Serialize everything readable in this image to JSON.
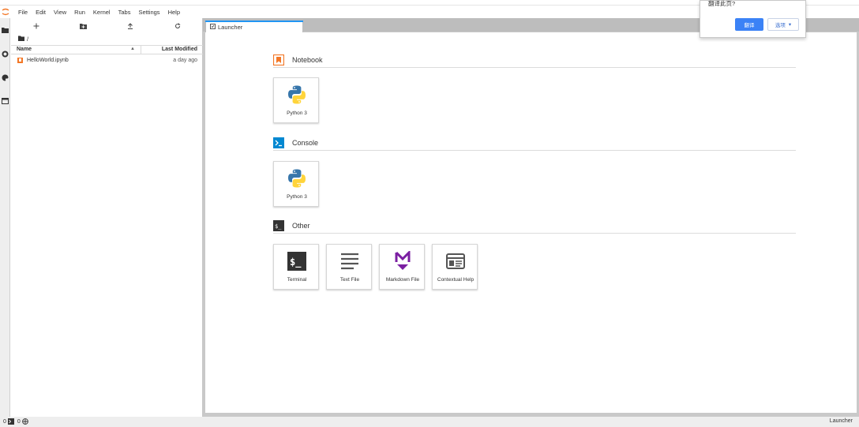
{
  "menu": [
    "File",
    "Edit",
    "View",
    "Run",
    "Kernel",
    "Tabs",
    "Settings",
    "Help"
  ],
  "file_browser": {
    "breadcrumb": "/",
    "columns": {
      "name": "Name",
      "modified": "Last Modified"
    },
    "files": [
      {
        "name": "HelloWorld.ipynb",
        "modified": "a day ago"
      }
    ]
  },
  "tab": {
    "label": "Launcher"
  },
  "launcher": {
    "sections": [
      {
        "title": "Notebook",
        "items": [
          "Python 3"
        ]
      },
      {
        "title": "Console",
        "items": [
          "Python 3"
        ]
      },
      {
        "title": "Other",
        "items": [
          "Terminal",
          "Text File",
          "Markdown File",
          "Contextual Help"
        ]
      }
    ]
  },
  "popup": {
    "text": "翻译此页?",
    "primary": "翻译",
    "options": "选项"
  },
  "status": {
    "terminals": "0",
    "kernels": "0",
    "mode": "Launcher"
  },
  "colors": {
    "accent": "#2196f3",
    "notebook": "#f37726",
    "console": "#0288d1",
    "markdown": "#7b1fa2",
    "button": "#3b82f6"
  }
}
